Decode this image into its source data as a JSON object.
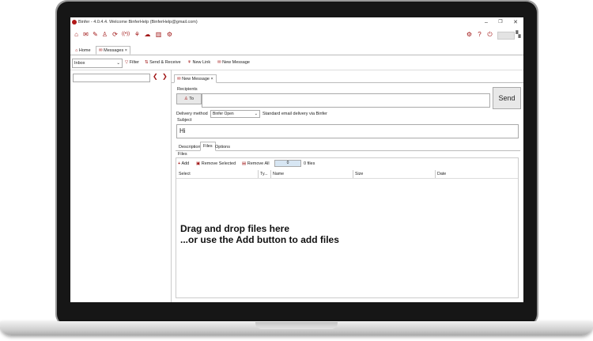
{
  "app": {
    "title": "Binfer - 4.0.4.4. Welcome BinferHelp (BinferHelp@gmail.com)",
    "accent": "#a01515"
  },
  "window_controls": {
    "minimize": "–",
    "maximize": "❐",
    "close": "✕"
  },
  "toolbar": {
    "icons": [
      "home-icon",
      "mail-icon",
      "chat-icon",
      "user-icon",
      "refresh-icon",
      "broadcast-icon",
      "share-icon",
      "cloud-icon",
      "barcode-icon",
      "network-icon"
    ],
    "right_icons": [
      "settings-icon",
      "help-icon",
      "power-icon"
    ]
  },
  "tabs": [
    {
      "label": "Home"
    },
    {
      "label": "Messages",
      "close": "×"
    }
  ],
  "actionbar": {
    "folder_select": "Inbox",
    "filter": "Filter",
    "send_receive": "Send & Receive",
    "new_link": "New Link",
    "new_message": "New Message"
  },
  "left_nav": {
    "prev": "❮",
    "next": "❯"
  },
  "message_tab": {
    "label": "New Message",
    "close": "×"
  },
  "form": {
    "recipients_label": "Recipients",
    "to_button": "To",
    "send_button": "Send",
    "delivery_label": "Delivery method",
    "delivery_value": "Binfer Open",
    "delivery_note": "Standard email delivery via Binfer",
    "subject_label": "Subject",
    "subject_value": "Hi"
  },
  "subtabs": [
    {
      "label": "Description"
    },
    {
      "label": "Files"
    },
    {
      "label": "Options"
    }
  ],
  "files": {
    "group_label": "Files",
    "add": "Add",
    "remove_selected": "Remove Selected",
    "remove_all": "Remove All",
    "progress_value": "0",
    "count": "0 files",
    "columns": [
      "Select",
      "Ty...",
      "Name",
      "Size",
      "Date"
    ],
    "drop_line1": "Drag and drop files here",
    "drop_line2": "...or use the Add button to add files"
  }
}
